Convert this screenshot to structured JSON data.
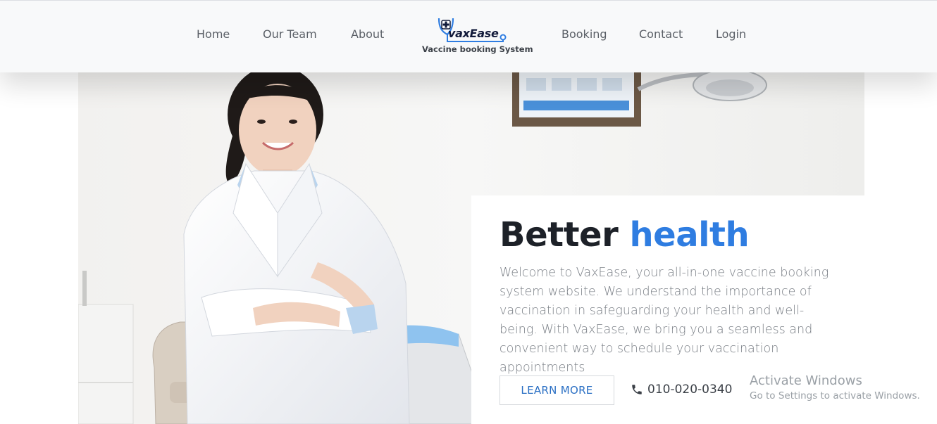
{
  "header": {
    "nav_left": [
      "Home",
      "Our Team",
      "About"
    ],
    "nav_right": [
      "Booking",
      "Contact",
      "Login"
    ],
    "logo": {
      "wordmark": "vaxEase",
      "tagline": "Vaccine booking System",
      "icon": "stethoscope-cross-icon"
    }
  },
  "hero": {
    "title_main": "Better",
    "title_accent": "health",
    "description": "Welcome to VaxEase, your all-in-one vaccine booking system website. We understand the importance of vaccination in safeguarding your health and well-being. With VaxEase, we bring you a seamless and convenient way to schedule your vaccination appointments",
    "cta_label": "LEARN MORE",
    "phone_icon": "phone-icon",
    "phone_number": "010-020-0340",
    "image_alt": "doctor-photo"
  },
  "watermark": {
    "title": "Activate Windows",
    "subtitle": "Go to Settings to activate Windows."
  },
  "colors": {
    "accent": "#2f7de1",
    "header_bg": "#f8f9fa",
    "text_dark": "#1d2128",
    "text_muted": "#7a7f86"
  }
}
